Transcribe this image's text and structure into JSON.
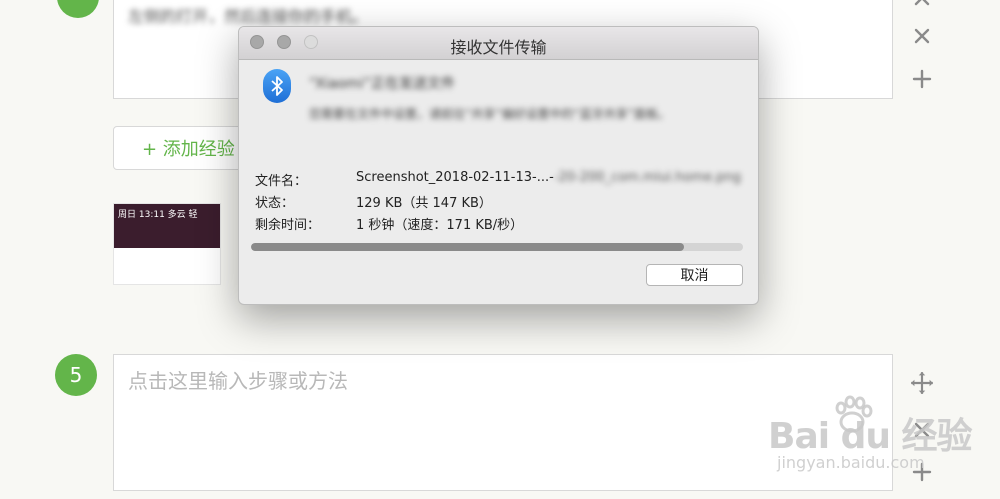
{
  "editor_top": {
    "blurred_text": "左侧的打开，然后连接你的手机。"
  },
  "add_experience_button": "+ 添加经验",
  "thumbnail": {
    "status_text": "周日 13:11 多云 轻"
  },
  "step5": {
    "number": "5",
    "placeholder": "点击这里输入步骤或方法"
  },
  "dialog": {
    "title": "接收文件传输",
    "message_title": "“Xiaomi”正在发送文件",
    "message_body": "您需要在文件中设置，请前往“共享”偏好设置中的“蓝牙共享”面板。",
    "labels": {
      "filename": "文件名：",
      "status": "状态：",
      "remaining": "剩余时间："
    },
    "values": {
      "filename": "Screenshot_2018-02-11-13-...-",
      "filename_blurred": "-20-200_com.miui.home.png",
      "status": "129 KB（共 147 KB）",
      "remaining": "1 秒钟（速度：171 KB/秒）"
    },
    "progress": 0.88,
    "cancel_label": "取消"
  },
  "watermark": {
    "brand": "Bai du 经验",
    "url": "jingyan.baidu.com"
  },
  "colors": {
    "accent": "#63b54a",
    "bluetooth": "#2f86e8"
  }
}
